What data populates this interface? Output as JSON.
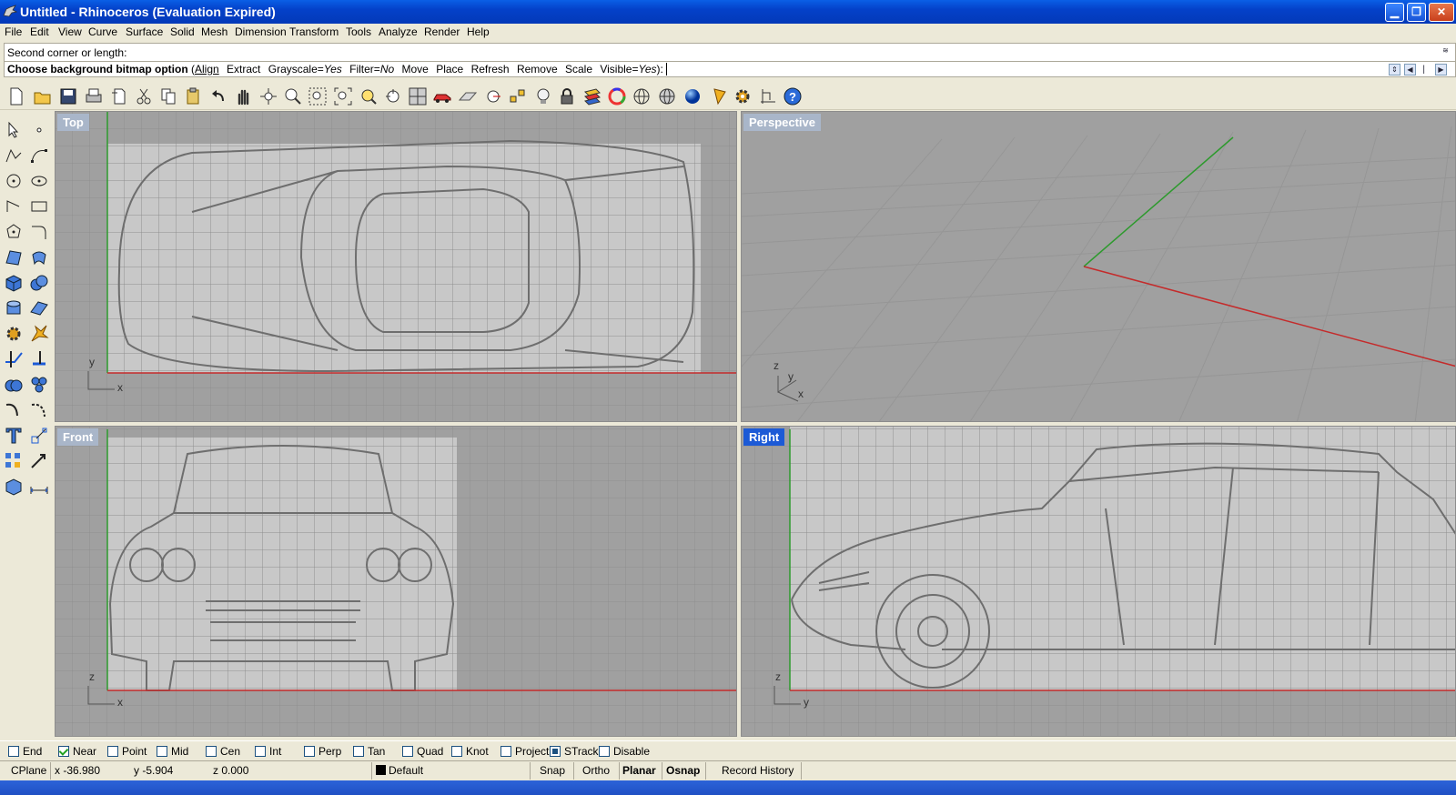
{
  "window": {
    "title": "Untitled - Rhinoceros (Evaluation Expired)",
    "title_bar_color": "#0441c9"
  },
  "menu": {
    "items": [
      "File",
      "Edit",
      "View",
      "Curve",
      "Surface",
      "Solid",
      "Mesh",
      "Dimension",
      "Transform",
      "Tools",
      "Analyze",
      "Render",
      "Help"
    ]
  },
  "command": {
    "history": "Second corner or length:",
    "prompt": "Choose background bitmap option",
    "open": "(",
    "options": [
      "Align",
      "Extract"
    ],
    "grayscale_label": "Grayscale=",
    "grayscale_value": "Yes",
    "filter_label": "Filter=",
    "filter_value": "No",
    "options2": [
      "Move",
      "Place",
      "Refresh",
      "Remove",
      "Scale"
    ],
    "visible_label": "Visible=",
    "visible_value": "Yes",
    "close": "):"
  },
  "toolbar_icons": [
    "new-icon",
    "open-icon",
    "save-icon",
    "print-icon",
    "import-icon",
    "cut-icon",
    "copy-icon",
    "paste-icon",
    "undo-icon",
    "pan-icon",
    "rotate-view-icon",
    "zoom-dynamic-icon",
    "zoom-window-icon",
    "zoom-extents-icon",
    "zoom-selected-icon",
    "undo-view-icon",
    "four-viewports-icon",
    "car-icon",
    "set-cplane-icon",
    "cplane-origin-icon",
    "object-snap-icon",
    "light-bulb-icon",
    "lock-icon",
    "layer-icon",
    "color-wheel-icon",
    "wireframe-sphere-icon",
    "ghosted-sphere-icon",
    "shaded-sphere-icon",
    "annotation-flag-icon",
    "options-gear-icon",
    "grid-snap-icon",
    "help-icon"
  ],
  "left_tool_icons": [
    "select-arrow-icon",
    "point-icon",
    "polyline-icon",
    "curve-control-points-icon",
    "circle-icon",
    "ellipse-icon",
    "arc-icon",
    "rectangle-icon",
    "polygon-icon",
    "fillet-curve-icon",
    "surface-corner-icon",
    "extrude-curve-icon",
    "box-icon",
    "sphere-icon",
    "cylinder-icon",
    "plane-surface-icon",
    "gear-tools-icon",
    "explode-icon",
    "split-icon",
    "trim-icon",
    "boolean-union-icon",
    "boolean-split-icon",
    "curve-fillet-icon",
    "blend-curve-icon",
    "text-icon",
    "scale-icon",
    "array-icon",
    "move-grip-icon",
    "block-icon",
    "dimension-icon"
  ],
  "viewports": [
    {
      "label": "Top",
      "axis_a": "y",
      "axis_b": "x",
      "active": false
    },
    {
      "label": "Perspective",
      "axis_a": "z",
      "axis_b": "y",
      "axis_c": "x",
      "active": false
    },
    {
      "label": "Front",
      "axis_a": "z",
      "axis_b": "x",
      "active": false
    },
    {
      "label": "Right",
      "axis_a": "z",
      "axis_b": "y",
      "active": true
    }
  ],
  "osnaps": [
    {
      "label": "End",
      "checked": false
    },
    {
      "label": "Near",
      "checked": true
    },
    {
      "label": "Point",
      "checked": false
    },
    {
      "label": "Mid",
      "checked": false
    },
    {
      "label": "Cen",
      "checked": false
    },
    {
      "label": "Int",
      "checked": false
    },
    {
      "label": "Perp",
      "checked": false
    },
    {
      "label": "Tan",
      "checked": false
    },
    {
      "label": "Quad",
      "checked": false
    },
    {
      "label": "Knot",
      "checked": false
    },
    {
      "label": "Project",
      "checked": false
    },
    {
      "label": "STrack",
      "checked": true
    },
    {
      "label": "Disable",
      "checked": false
    }
  ],
  "status": {
    "cplane": "CPlane",
    "x": "x -36.980",
    "y": "y -5.904",
    "z": "z 0.000",
    "layer": "Default",
    "layer_color": "#000000",
    "snap": "Snap",
    "ortho": "Ortho",
    "planar": "Planar",
    "osnap": "Osnap",
    "record_history": "Record History"
  },
  "colors": {
    "x_axis": "#c42b2b",
    "y_axis": "#2e9a2e",
    "active_viewport_label": "#1c5ad6",
    "inactive_viewport_label": "#a9b6c9"
  }
}
